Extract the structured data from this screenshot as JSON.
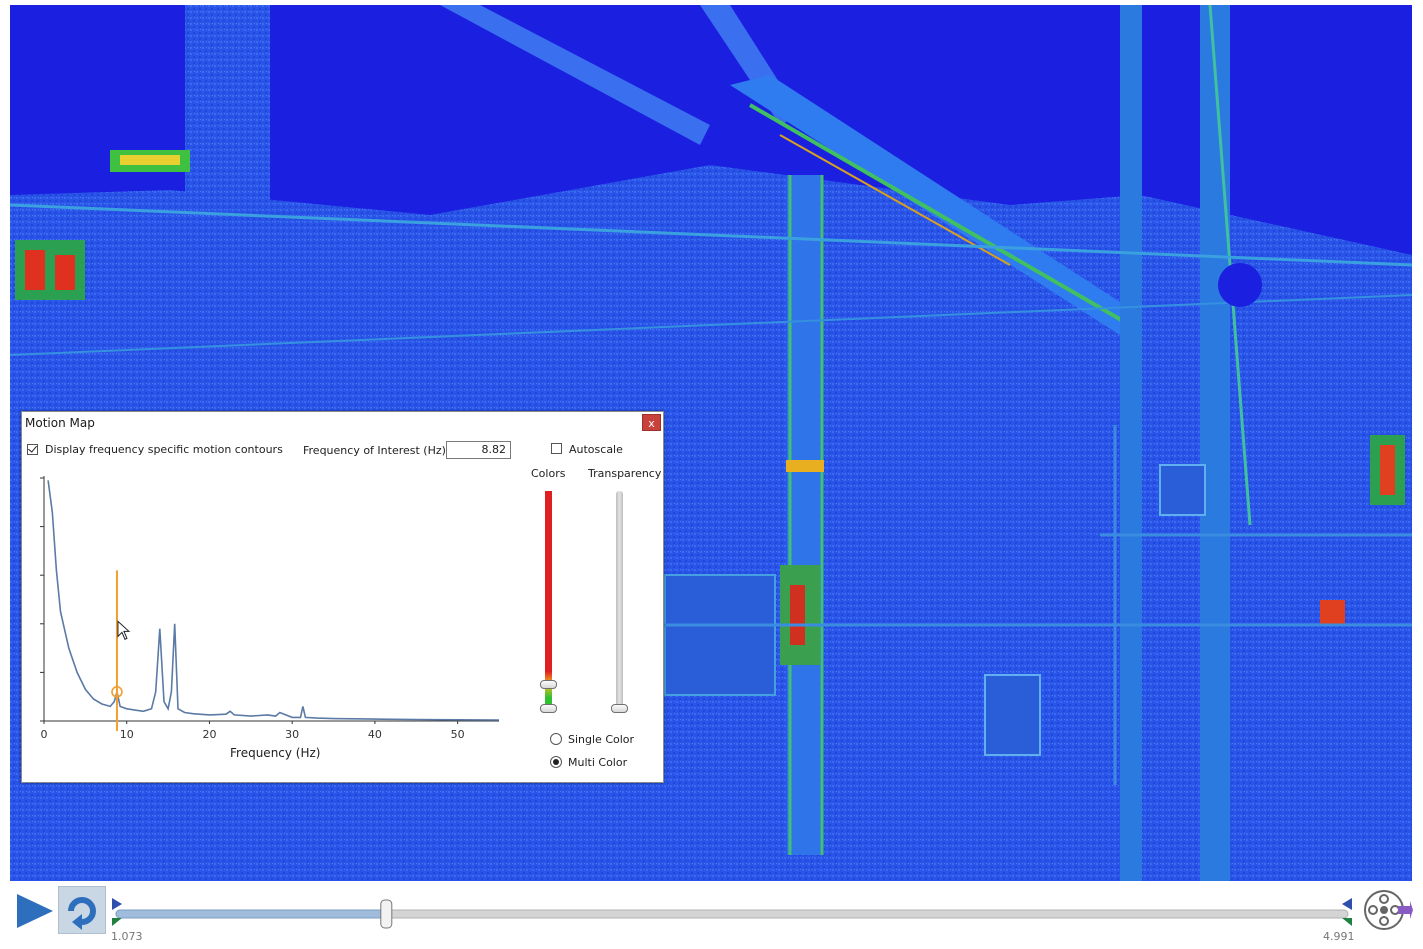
{
  "panel": {
    "title": "Motion Map",
    "close_label": "x",
    "display_contours_label": "Display frequency specific motion contours",
    "display_contours_checked": true,
    "freq_label": "Frequency of Interest (Hz):",
    "freq_value": "8.82",
    "autoscale_label": "Autoscale",
    "autoscale_checked": false,
    "colors_label": "Colors",
    "transparency_label": "Transparency",
    "single_color_label": "Single Color",
    "multi_color_label": "Multi Color",
    "color_mode": "Multi Color"
  },
  "chart_data": {
    "type": "line",
    "xlabel": "Frequency (Hz)",
    "ylabel": "",
    "xlim": [
      0,
      55
    ],
    "ylim": [
      0,
      1
    ],
    "xticks": [
      "0",
      "10",
      "20",
      "30",
      "40",
      "50"
    ],
    "x": [
      0.5,
      1,
      1.5,
      2,
      3,
      4,
      5,
      6,
      7,
      8,
      8.5,
      8.82,
      9.2,
      10,
      11,
      12,
      13,
      13.5,
      14,
      14.5,
      15,
      15.4,
      15.8,
      16.2,
      17,
      18,
      20,
      22,
      22.5,
      23,
      25,
      27,
      28,
      28.5,
      30,
      31,
      31.3,
      31.6,
      33,
      35,
      40,
      45,
      50,
      55
    ],
    "values": [
      0.99,
      0.86,
      0.62,
      0.45,
      0.3,
      0.2,
      0.13,
      0.09,
      0.07,
      0.06,
      0.08,
      0.12,
      0.06,
      0.05,
      0.045,
      0.04,
      0.05,
      0.12,
      0.38,
      0.08,
      0.05,
      0.12,
      0.4,
      0.05,
      0.035,
      0.03,
      0.025,
      0.028,
      0.04,
      0.025,
      0.02,
      0.025,
      0.02,
      0.035,
      0.015,
      0.015,
      0.06,
      0.015,
      0.012,
      0.01,
      0.008,
      0.006,
      0.005,
      0.004
    ],
    "marker_frequency": 8.82
  },
  "playback": {
    "start_time": "1.073",
    "end_time": "4.991",
    "position_fraction": 0.219
  },
  "colors": {
    "video_background": "#1a3cf0",
    "spectrum_line": "#5b7aa6",
    "marker": "#f0a030",
    "accent_blue": "#2e6fbd"
  },
  "icons": {
    "play": "play-icon",
    "loop": "loop-icon",
    "export": "film-reel-export-icon"
  }
}
